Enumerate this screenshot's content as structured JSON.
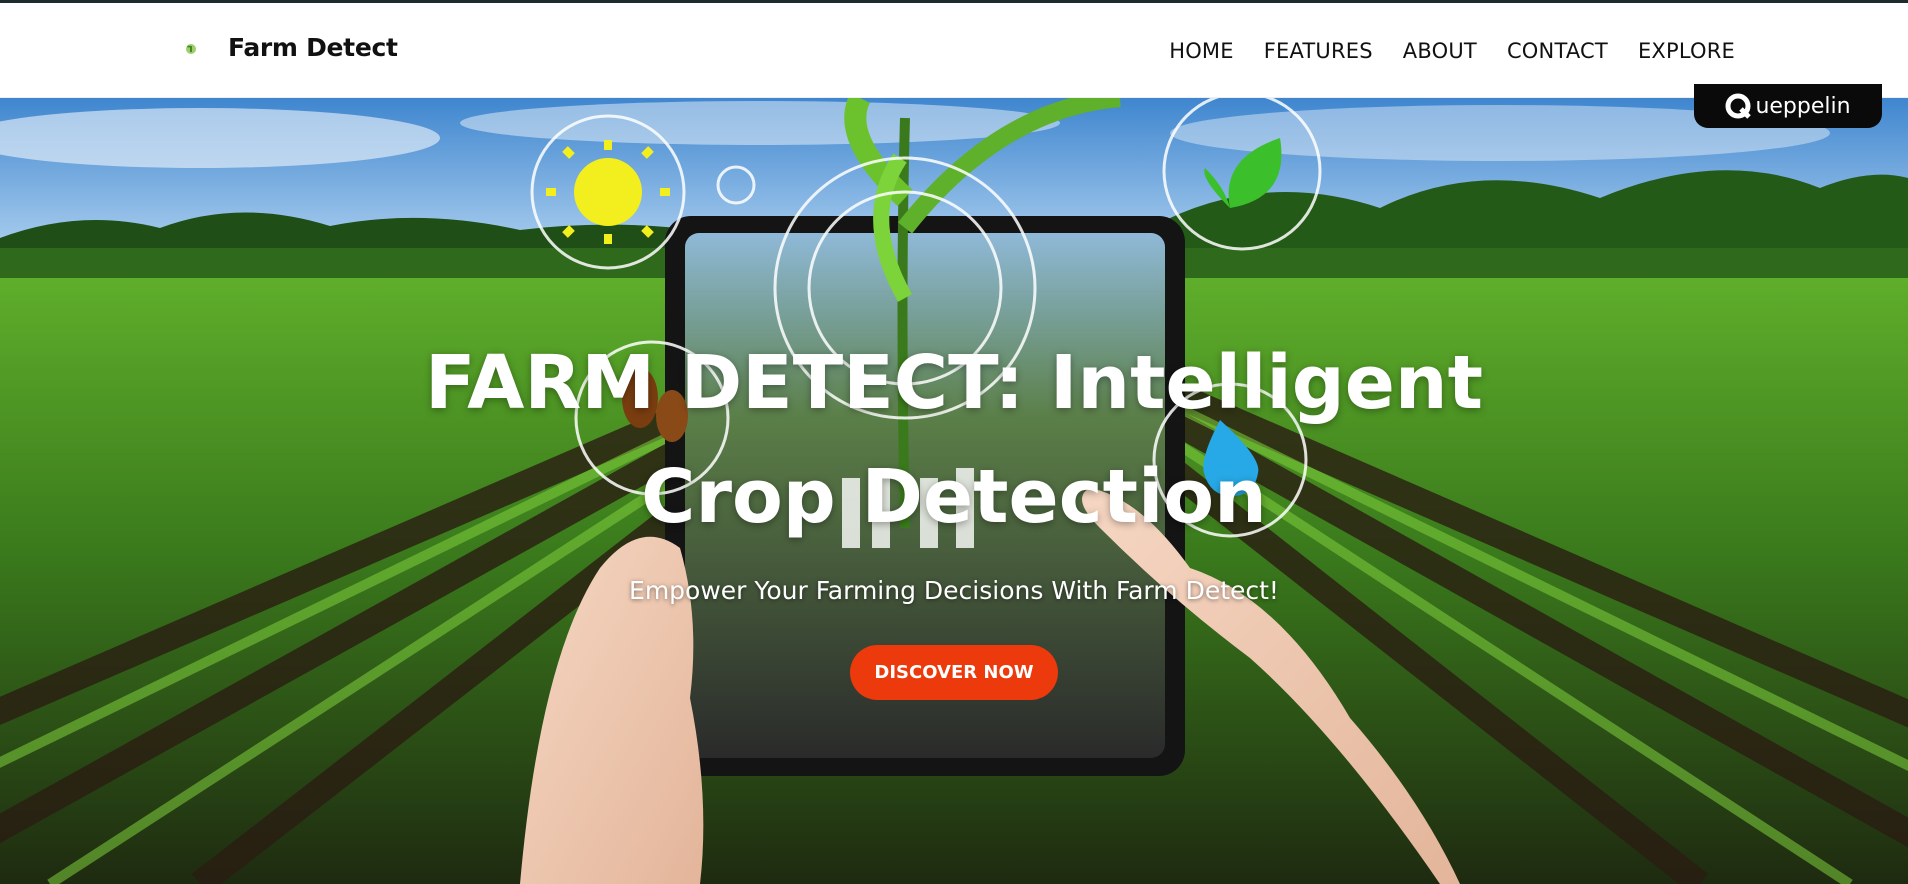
{
  "brand": {
    "name": "Farm Detect",
    "logo_icon": "sprout-logo-icon"
  },
  "nav": {
    "items": [
      {
        "label": "HOME"
      },
      {
        "label": "FEATURES"
      },
      {
        "label": "ABOUT"
      },
      {
        "label": "CONTACT"
      },
      {
        "label": "EXPLORE"
      }
    ]
  },
  "hero": {
    "title": "FARM DETECT: Intelligent Crop Detection",
    "subtitle": "Empower Your Farming Decisions With Farm Detect!",
    "cta_label": "DISCOVER NOW"
  },
  "badge": {
    "text": "ueppelin"
  },
  "colors": {
    "accent": "#ec3a0c",
    "navbar_bg": "#ffffff",
    "sky": "#5fa2dc",
    "field_green": "#3f8a1e",
    "soil": "#2e2218"
  }
}
